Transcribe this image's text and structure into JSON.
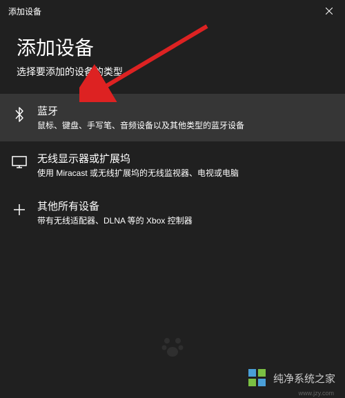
{
  "titleBar": {
    "title": "添加设备"
  },
  "heading": "添加设备",
  "subtitle": "选择要添加的设备的类型。",
  "options": [
    {
      "icon": "bluetooth",
      "title": "蓝牙",
      "description": "鼠标、键盘、手写笔、音频设备以及其他类型的蓝牙设备",
      "highlighted": true
    },
    {
      "icon": "display",
      "title": "无线显示器或扩展坞",
      "description": "使用 Miracast 或无线扩展坞的无线监视器、电视或电脑"
    },
    {
      "icon": "plus",
      "title": "其他所有设备",
      "description": "带有无线适配器、DLNA 等的 Xbox 控制器"
    }
  ],
  "watermark": {
    "text": "纯净系统之家",
    "url": "www.jzy.com"
  },
  "colors": {
    "background": "#202020",
    "highlighted": "#363636",
    "arrow": "#dd2222",
    "logoBlue": "#4a9fd8",
    "logoGreen": "#7bc043"
  }
}
